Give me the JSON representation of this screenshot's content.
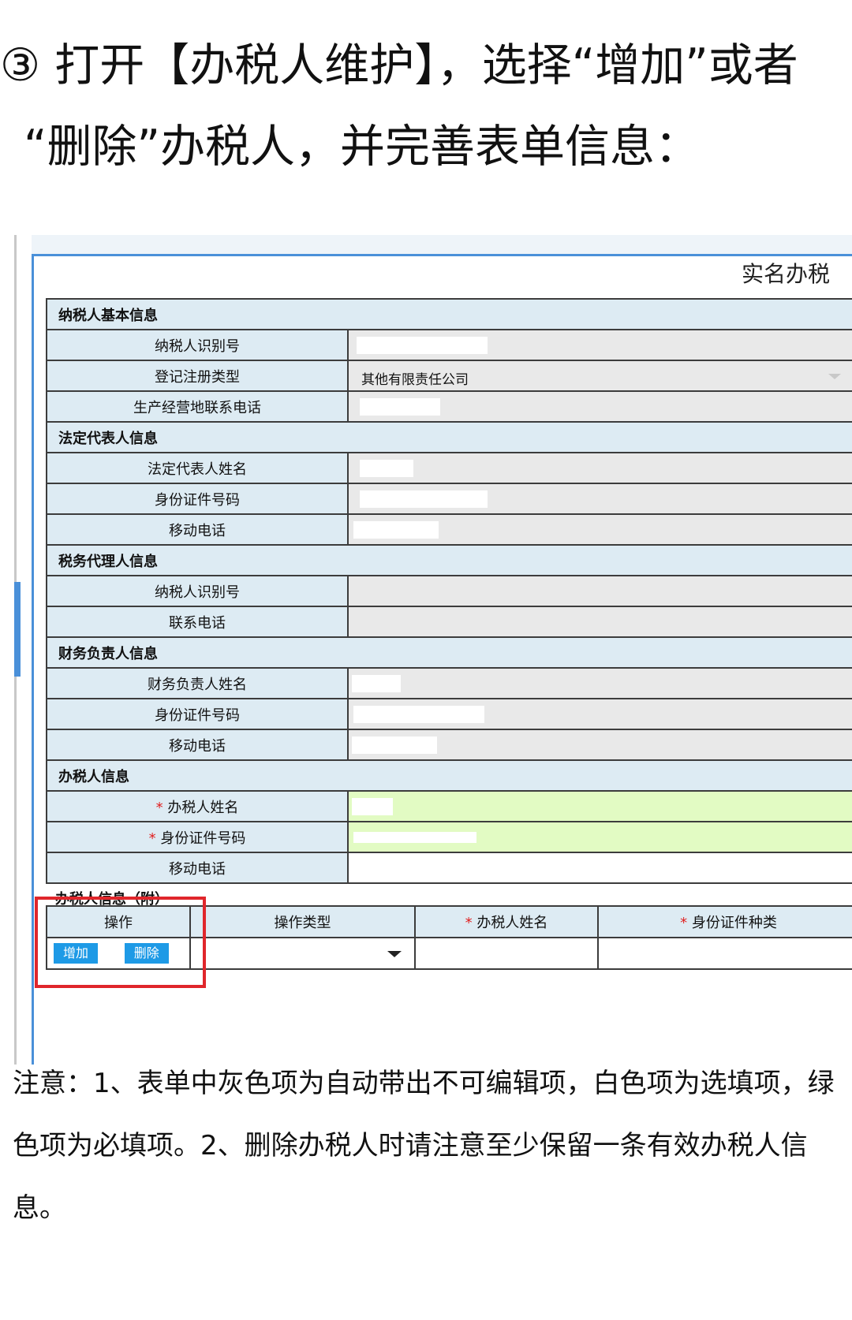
{
  "heading": {
    "line1": "③ 打开【办税人维护】，选择“增加”或者",
    "line2": "“删除”办税人，并完善表单信息："
  },
  "form": {
    "title": "实名办税",
    "sections": [
      {
        "title": "纳税人基本信息",
        "fields": [
          {
            "label": "纳税人识别号",
            "style": "gray"
          },
          {
            "label": "登记注册类型",
            "style": "gray",
            "value": "其他有限责任公司",
            "dropdown": true
          },
          {
            "label": "生产经营地联系电话",
            "style": "gray"
          }
        ]
      },
      {
        "title": "法定代表人信息",
        "fields": [
          {
            "label": "法定代表人姓名",
            "style": "gray"
          },
          {
            "label": "身份证件号码",
            "style": "gray"
          },
          {
            "label": "移动电话",
            "style": "gray"
          }
        ]
      },
      {
        "title": "税务代理人信息",
        "fields": [
          {
            "label": "纳税人识别号",
            "style": "gray"
          },
          {
            "label": "联系电话",
            "style": "gray"
          }
        ]
      },
      {
        "title": "财务负责人信息",
        "fields": [
          {
            "label": "财务负责人姓名",
            "style": "gray"
          },
          {
            "label": "身份证件号码",
            "style": "gray"
          },
          {
            "label": "移动电话",
            "style": "gray"
          }
        ]
      },
      {
        "title": "办税人信息",
        "fields": [
          {
            "label": "办税人姓名",
            "style": "green",
            "required": true
          },
          {
            "label": "身份证件号码",
            "style": "green",
            "required": true
          },
          {
            "label": "移动电话",
            "style": "white"
          }
        ]
      }
    ],
    "required_mark": "*",
    "sub_section": {
      "title": "办税人信息（附）",
      "headers": [
        "操作",
        "操作类型",
        "办税人姓名",
        "身份证件种类"
      ],
      "add_button": "增加",
      "delete_button": "删除"
    }
  },
  "note": "注意：1、表单中灰色项为自动带出不可编辑项，白色项为选填项，绿色项为必填项。2、删除办税人时请注意至少保留一条有效办税人信息。",
  "colors": {
    "section_bg": "#ddebf3",
    "readonly_bg": "#e9e9e9",
    "required_bg": "#e2fbc3",
    "button": "#1e9ae6",
    "highlight": "#e0262b"
  }
}
